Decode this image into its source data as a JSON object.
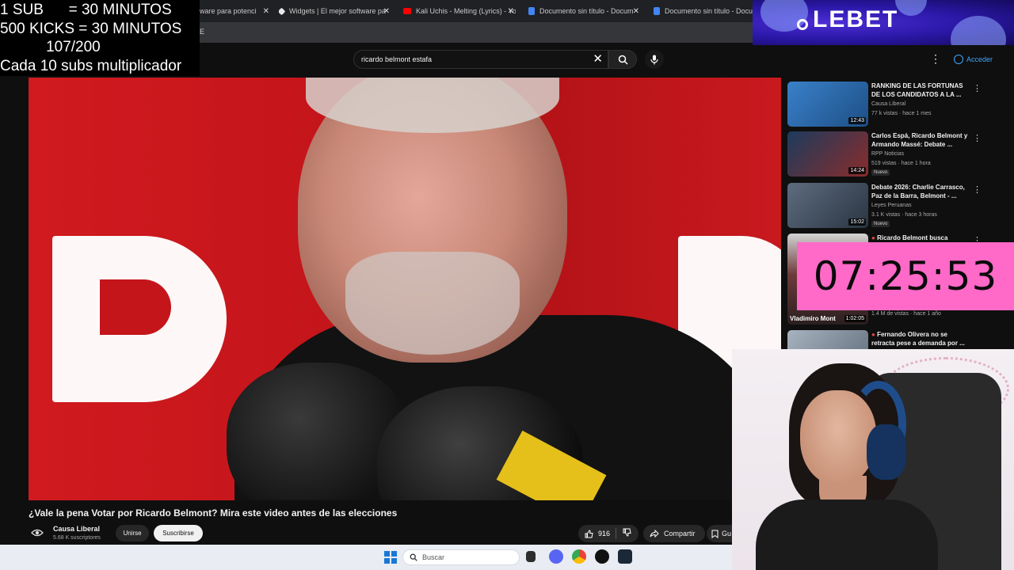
{
  "browser": {
    "tabs": [
      {
        "label": "ware para potenci",
        "fav_color": "#7b7b7b"
      },
      {
        "label": "Widgets | El mejor software pa",
        "fav_color": "#e8e8e8"
      },
      {
        "label": "Kali Uchis - Melting (Lyrics) - Yo",
        "fav_color": "#ff0000"
      },
      {
        "label": "Documento sin título - Docum",
        "fav_color": "#4285f4"
      },
      {
        "label": "Documento sin título - Docum",
        "fav_color": "#4285f4"
      }
    ],
    "close_glyph": "✕",
    "address_fragment": "E"
  },
  "header": {
    "search_value": "ricardo belmont estafa",
    "clear_glyph": "✕",
    "signin_label": "Acceder",
    "menu_glyph": "⋮"
  },
  "video": {
    "title": "¿Vale la pena Votar por Ricardo Belmont? Mira este video antes de las elecciones",
    "channel_name": "Causa Liberal",
    "channel_subs": "5.68 K suscriptores",
    "join_label": "Unirse",
    "subscribe_label": "Suscribirse",
    "like_count": "916",
    "share_label": "Compartir",
    "save_label": "Gu"
  },
  "recommendations": [
    {
      "title": "RANKING DE LAS FORTUNAS DE LOS CANDIDATOS A LA ...",
      "channel": "Causa Liberal",
      "meta": "77 k vistas · hace 1 mes",
      "duration": "12:43",
      "badge": "",
      "thumb": "#2f6fb6"
    },
    {
      "title": "Carlos Espá, Ricardo Belmont y Armando Massé: Debate ...",
      "channel": "RPP Noticias",
      "meta": "519 vistas · hace 1 hora",
      "duration": "14:24",
      "badge": "Nuevo",
      "thumb": "#7a2d2d"
    },
    {
      "title": "Debate 2026: Charlie Carrasco, Paz de la Barra, Belmont - ...",
      "channel": "Leyes Peruanas",
      "meta": "3.1 K vistas · hace 3 horas",
      "duration": "15:02",
      "badge": "Nuevo",
      "thumb": "#3a4a5e"
    },
    {
      "title": "Ricardo Belmont busca",
      "channel": "",
      "meta": "1.4 M de vistas · hace 1 año",
      "duration": "1:02:05",
      "badge": "",
      "thumb": "#5a3232",
      "caption": "Vladimiro Mont"
    },
    {
      "title": "Fernando Olivera no se retracta pese a demanda por ...",
      "channel": "",
      "meta": "",
      "duration": "",
      "badge": "",
      "thumb": "#8a9aa8"
    }
  ],
  "stream_overlay": {
    "lines": [
      "1 SUB      = 30 MINUTOS",
      "500 KICKS = 30 MINUTOS",
      "           107/200",
      "Cada 10 subs multiplicador"
    ],
    "timer": "07:25:53",
    "timer_color": "#ff69c8",
    "brand": "LEBET"
  },
  "taskbar": {
    "search_placeholder": "Buscar"
  }
}
